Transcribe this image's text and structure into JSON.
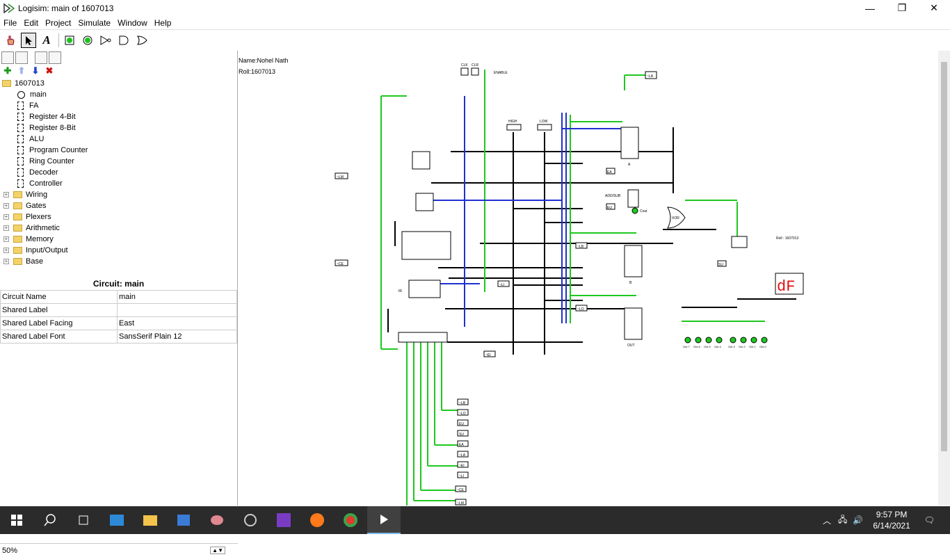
{
  "window": {
    "title": "Logisim: main of 1607013",
    "minimize": "—",
    "maximize": "❐",
    "close": "✕"
  },
  "menu": [
    "File",
    "Edit",
    "Project",
    "Simulate",
    "Window",
    "Help"
  ],
  "toolbar": {
    "tools": [
      "hand-poke-icon",
      "select-arrow-icon",
      "text-tool-icon",
      "input-pin-icon",
      "output-pin-icon",
      "not-gate-icon",
      "and-gate-icon",
      "or-gate-icon"
    ]
  },
  "explorer": {
    "project": "1607013",
    "circuits": [
      "main",
      "FA",
      "Register 4-Bit",
      "Register 8-Bit",
      "ALU",
      "Program Counter",
      "Ring Counter",
      "Decoder",
      "Controller"
    ],
    "libraries": [
      "Wiring",
      "Gates",
      "Plexers",
      "Arithmetic",
      "Memory",
      "Input/Output",
      "Base"
    ]
  },
  "attributes": {
    "title": "Circuit: main",
    "rows": [
      {
        "name": "Circuit Name",
        "value": "main"
      },
      {
        "name": "Shared Label",
        "value": ""
      },
      {
        "name": "Shared Label Facing",
        "value": "East"
      },
      {
        "name": "Shared Label Font",
        "value": "SansSerif Plain 12"
      }
    ]
  },
  "zoom": "50%",
  "canvas": {
    "name_label": "Name:Nohel Nath",
    "roll_label": "Roll:1607013",
    "roll_small": "Roll : 1607013",
    "clk": "CLK",
    "clr": "CLR",
    "enable": "ENABLE",
    "high": "HIGH",
    "low": "LOW",
    "addsub": "ADD/SUB",
    "cout": "Cout",
    "xor": "XOR",
    "ir": "IR",
    "reg_a": "A",
    "reg_b": "B",
    "out": "OUT",
    "display": "dF",
    "pins": [
      "~LM",
      "~CE",
      "~LI",
      "~EI",
      "~LA",
      "EA",
      "EU",
      "SU",
      "~LB",
      "~LO"
    ],
    "ctrl_pins": [
      "~LB",
      "~LO",
      "EU",
      "SU",
      "EA",
      "~LA",
      "~EI",
      "~LI",
      "~CE",
      "~LM"
    ],
    "outs": [
      "Out 7",
      "Out 6",
      "Out 5",
      "Out 4",
      "Out 3",
      "Out 2",
      "Out 1",
      "Out 0"
    ]
  },
  "taskbar": {
    "time": "9:57 PM",
    "date": "6/14/2021"
  }
}
